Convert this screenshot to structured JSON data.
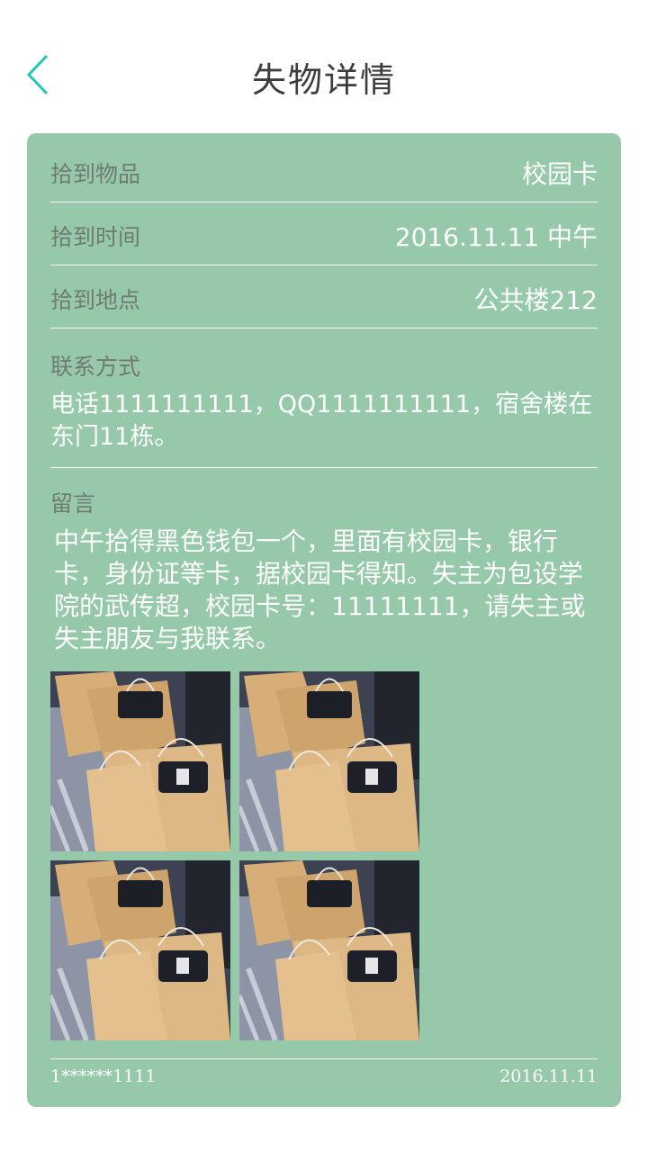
{
  "header": {
    "back_icon": "chevron-left-icon",
    "title": "失物详情",
    "accent_color": "#22c7b8"
  },
  "details": {
    "item": {
      "label": "拾到物品",
      "value": "校园卡"
    },
    "time": {
      "label": "拾到时间",
      "value": "2016.11.11 中午"
    },
    "place": {
      "label": "拾到地点",
      "value": "公共楼212"
    },
    "contact": {
      "label": "联系方式",
      "text": "电话1111111111，QQ1111111111，宿舍楼在东门11栋。"
    },
    "message": {
      "label": "留言",
      "text": "中午拾得黑色钱包一个，里面有校园卡，银行卡，身份证等卡，据校园卡得知。失主为包设学院的武传超，校园卡号：11111111，请失主或失主朋友与我联系。"
    }
  },
  "photos": [
    "shopping-bags-photo",
    "shopping-bags-photo",
    "shopping-bags-photo",
    "shopping-bags-photo"
  ],
  "footer": {
    "user": "1******1111",
    "date": "2016.11.11"
  },
  "colors": {
    "card_bg": "#96c8aa",
    "label": "#6f7b73",
    "value": "#ffffff"
  }
}
